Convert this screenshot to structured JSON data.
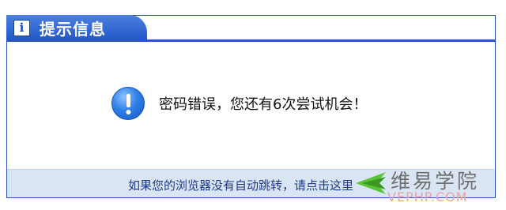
{
  "dialog": {
    "title": "提示信息",
    "info_icon_glyph": "i",
    "alert_icon": "exclamation-circle-icon",
    "message": "密码错误，您还有6次尝试机会！",
    "redirect_link": "如果您的浏览器没有自动跳转，请点击这里"
  },
  "watermark": {
    "cn": "维易学院",
    "en": "VEPHP.COM"
  },
  "colors": {
    "title_bar": "#2257c7",
    "border": "#2a56b8",
    "footer_bg": "#d9e5f3",
    "link": "#1f3a8a",
    "alert_icon": "#2f7fe8"
  }
}
